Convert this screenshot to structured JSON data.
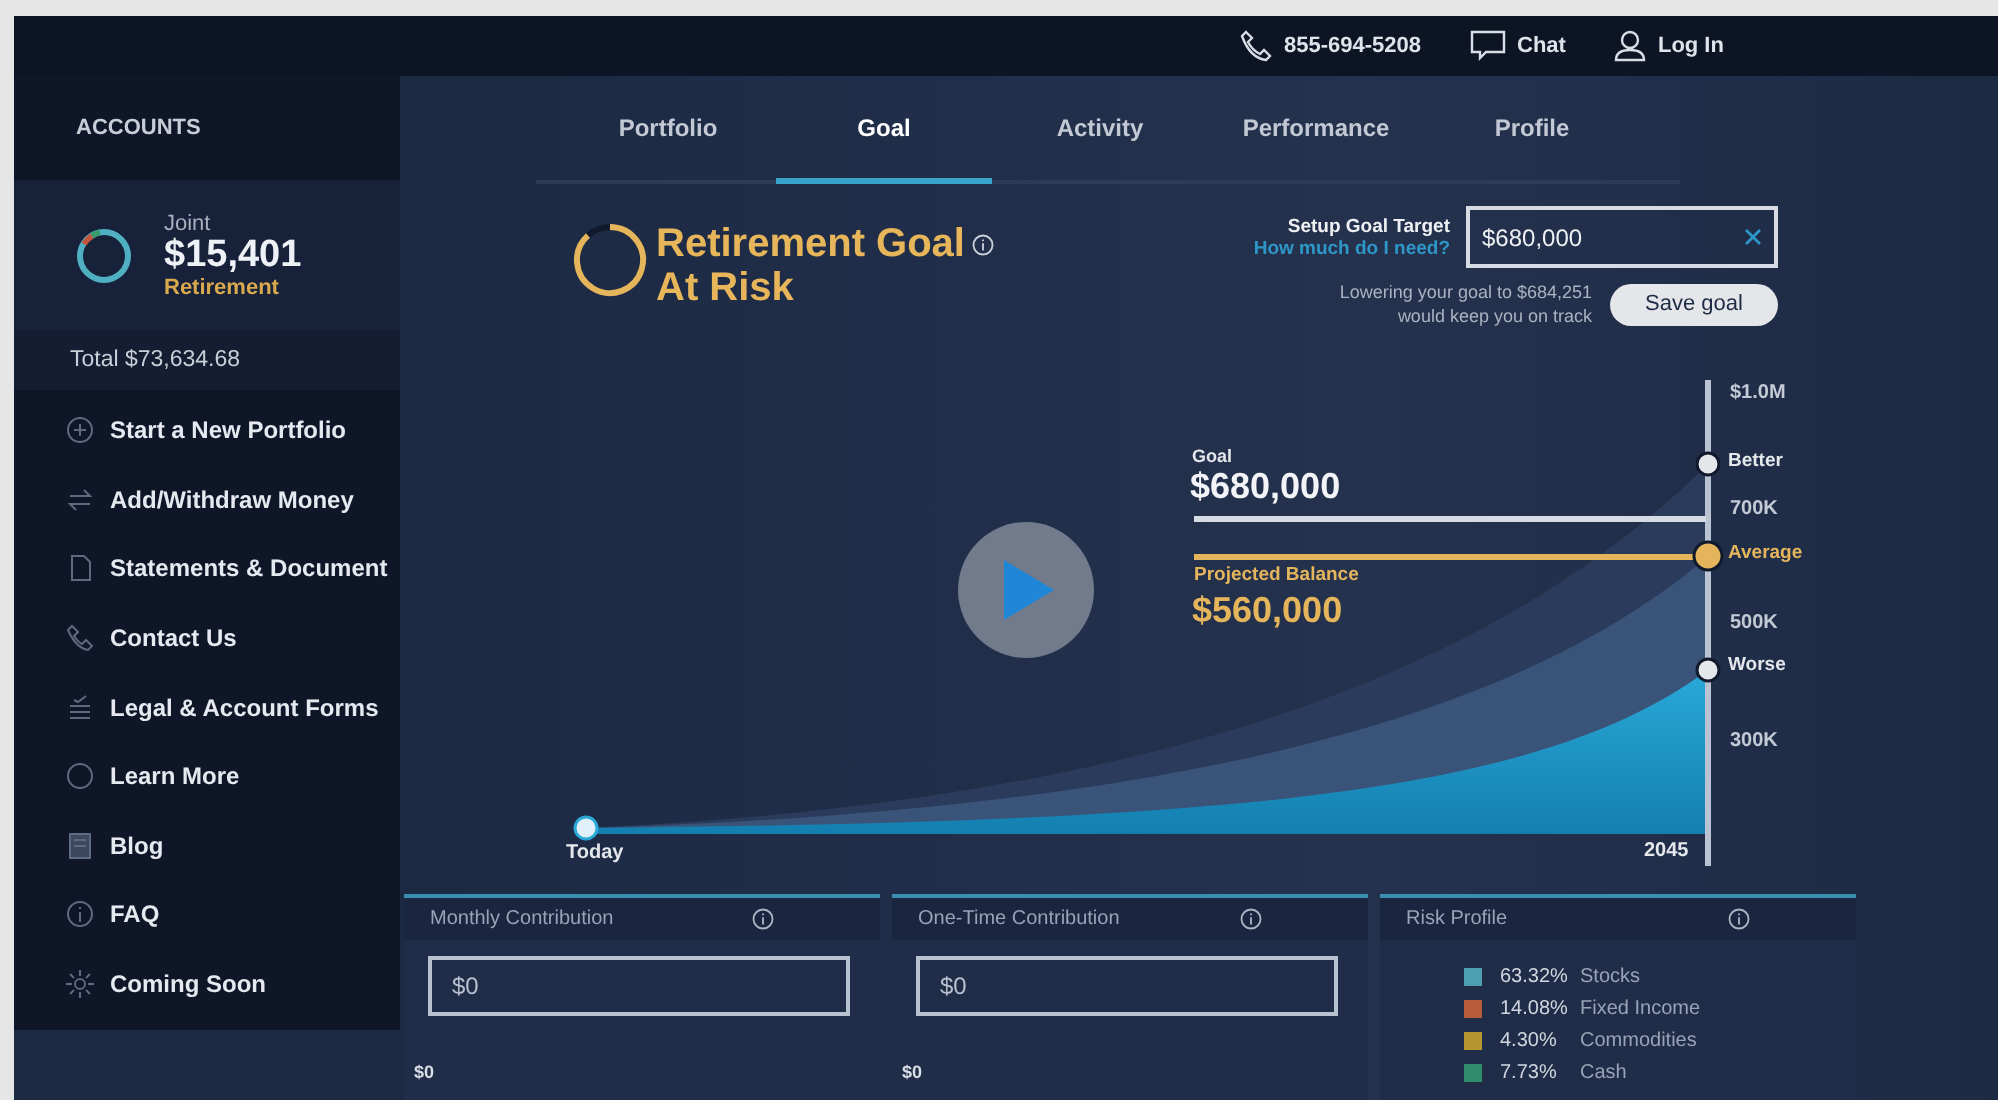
{
  "topbar": {
    "phone": "855-694-5208",
    "chat": "Chat",
    "login": "Log In"
  },
  "sidebar": {
    "heading": "ACCOUNTS",
    "account": {
      "type": "Joint",
      "balance": "$15,401",
      "name": "Retirement"
    },
    "total": "Total $73,634.68",
    "items": [
      {
        "label": "Start a New Portfolio"
      },
      {
        "label": "Add/Withdraw Money"
      },
      {
        "label": "Statements & Document"
      },
      {
        "label": "Contact Us"
      },
      {
        "label": "Legal & Account Forms"
      },
      {
        "label": "Learn More"
      },
      {
        "label": "Blog"
      },
      {
        "label": "FAQ"
      },
      {
        "label": "Coming Soon"
      }
    ]
  },
  "tabs": [
    {
      "label": "Portfolio",
      "selected": false
    },
    {
      "label": "Goal",
      "selected": true
    },
    {
      "label": "Activity",
      "selected": false
    },
    {
      "label": "Performance",
      "selected": false
    },
    {
      "label": "Profile",
      "selected": false
    }
  ],
  "goal_status": {
    "title": "Retirement Goal",
    "status": "At Risk"
  },
  "goal_target": {
    "label": "Setup Goal Target",
    "link": "How much do I need?",
    "value": "$680,000",
    "hint": "Lowering your goal to $684,251\nwould keep you on track",
    "button": "Save goal"
  },
  "chart": {
    "axis_labels": [
      "$1.0M",
      "700K",
      "500K",
      "300K"
    ],
    "scenarios": [
      {
        "label": "Better",
        "highlighted": false
      },
      {
        "label": "Average",
        "highlighted": true
      },
      {
        "label": "Worse",
        "highlighted": false
      }
    ],
    "goal": {
      "label": "Goal",
      "value": "$680,000"
    },
    "projected": {
      "label": "Projected Balance",
      "value": "$560,000"
    },
    "start": "Today",
    "end": "2045"
  },
  "panels": [
    {
      "title": "Monthly Contribution",
      "kind": "input",
      "value": "$0",
      "min": "$0"
    },
    {
      "title": "One-Time Contribution",
      "kind": "input",
      "value": "$0",
      "min": "$0"
    },
    {
      "title": "Risk Profile",
      "kind": "legend",
      "items": [
        {
          "percent": "63.32%",
          "label": "Stocks",
          "color": "#4b9fae"
        },
        {
          "percent": "14.08%",
          "label": "Fixed Income",
          "color": "#b65c3a"
        },
        {
          "percent": "4.30%",
          "label": "Commodities",
          "color": "#b8962f"
        },
        {
          "percent": "7.73%",
          "label": "Cash",
          "color": "#2f8c6c"
        }
      ]
    }
  ]
}
